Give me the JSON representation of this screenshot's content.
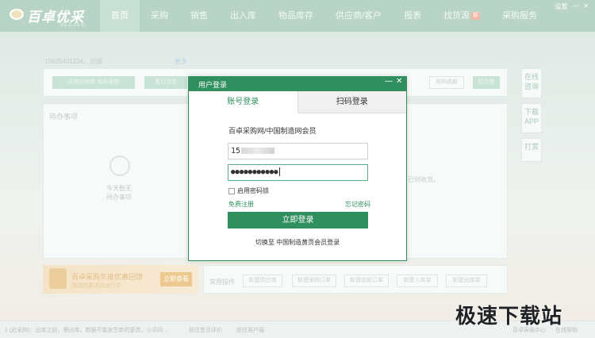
{
  "app": {
    "logo_name": "百卓优采",
    "logo_version": "V1.2.31.8",
    "nav": [
      {
        "label": "首页",
        "active": true
      },
      {
        "label": "采购"
      },
      {
        "label": "销售"
      },
      {
        "label": "出入库"
      },
      {
        "label": "物品库存"
      },
      {
        "label": "供应商/客户"
      },
      {
        "label": "报表"
      },
      {
        "label": "找货源",
        "badge": "新"
      },
      {
        "label": "采购服务"
      }
    ],
    "window_controls": {
      "settings": "设置",
      "minimize": "—",
      "close": "✕"
    },
    "account_line": "15625431234，刘成",
    "account_link": "更多",
    "todo_title": "待办事项",
    "buttons_row": [
      "采购应收款 和报表图",
      "看行动态"
    ],
    "right_buttons": [
      "采购收款",
      "批次图"
    ],
    "empty_hint_1": "今天暂无",
    "empty_hint_2": "待办事项",
    "right_hint": "已到收货。",
    "side_buttons": [
      "在线咨询",
      "下载APP",
      "打赏"
    ],
    "banner": {
      "title": "百卓采购年度优惠回馈",
      "sub": "精选特惠活动进行中",
      "button": "立即查看"
    },
    "quick_label": "常用操作",
    "quick_buttons": [
      "新建供应商",
      "新建采购订单",
      "新建收款订单",
      "新建入库单",
      "新建出库单"
    ],
    "status": {
      "left": "1 (武采购)：出库之前，需出库，数据不能发生新的更改，小卓同...",
      "mid1": "前往首页评价",
      "mid2": "前往客户端",
      "right1": "百卓客服中心",
      "right2": "在线帮助"
    },
    "watermark": "极速下载站"
  },
  "dialog": {
    "title": "用户登录",
    "minimize": "—",
    "close": "✕",
    "tabs": [
      {
        "label": "账号登录",
        "active": true
      },
      {
        "label": "扫码登录",
        "active": false
      }
    ],
    "member_label": "百卓采购网/中国制造网会员",
    "username_value": "15",
    "password_value": "●●●●●●●●●●●",
    "remember_label": "启用密码锁",
    "register_link": "免费注册",
    "forgot_link": "忘记密码",
    "login_button": "立即登录",
    "switch_text": "切换至 中国制造黄页会员登录",
    "accent_color": "#2f8f5e"
  }
}
